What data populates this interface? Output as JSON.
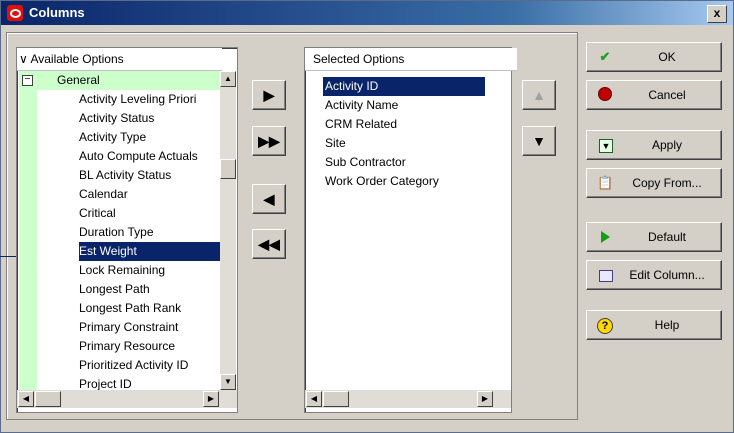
{
  "window": {
    "title": "Columns",
    "close_label": "x"
  },
  "available": {
    "header": "Available Options",
    "group_label": "General",
    "items": [
      "Activity Leveling Priori",
      "Activity Status",
      "Activity Type",
      "Auto Compute Actuals",
      "BL Activity Status",
      "Calendar",
      "Critical",
      "Duration Type",
      "Est Weight",
      "Lock Remaining",
      "Longest Path",
      "Longest Path Rank",
      "Primary Constraint",
      "Primary Resource",
      "Prioritized Activity ID",
      "Project ID"
    ],
    "selected_item": "Est Weight"
  },
  "selected": {
    "header": "Selected Options",
    "items": [
      "Activity ID",
      "Activity Name",
      "CRM Related",
      "Site",
      "Sub Contractor",
      "Work Order Category"
    ],
    "selected_item": "Activity ID"
  },
  "buttons": {
    "ok": "OK",
    "cancel": "Cancel",
    "apply": "Apply",
    "copy_from": "Copy From...",
    "default": "Default",
    "edit_column": "Edit Column...",
    "help": "Help"
  },
  "icons": {
    "ok": "checkmark-icon",
    "cancel": "no-entry-icon",
    "apply": "apply-icon",
    "copy_from": "copy-icon",
    "default": "play-icon",
    "edit_column": "edit-column-icon",
    "help": "help-icon"
  },
  "colors": {
    "selection": "#0a246a",
    "group_band": "#ccffcc",
    "titlebar": "#0a246a"
  }
}
